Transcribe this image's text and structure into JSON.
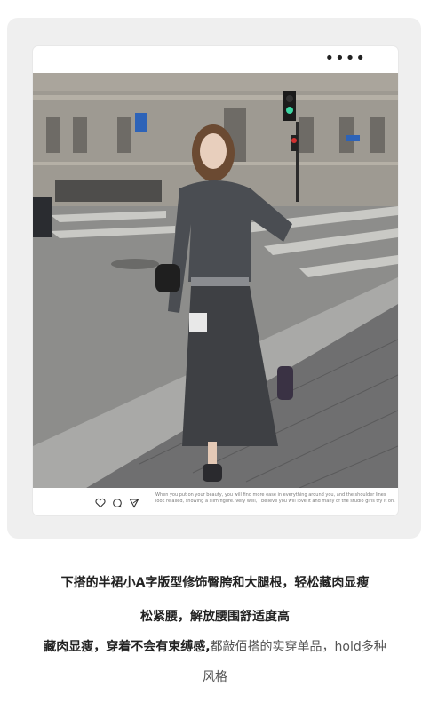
{
  "post": {
    "more_label": "••••",
    "caption": "When you put on your beauty, you will find more ease in everything around you, and the shoulder lines look relaxed, showing a slim figure. Very well, I believe you will love it and many of the studio girls try it on."
  },
  "description": {
    "line1": "下搭的半裙小A字版型修饰臀胯和大腿根，轻松藏肉显瘦",
    "line2": "松紧腰，解放腰围舒适度高",
    "line3_bold": "藏肉显瘦，穿着不会有束缚感,",
    "line3_light": "都敲佰搭的实穿单品，hold多种",
    "line4": "风格"
  },
  "icons": [
    "heart-icon",
    "comment-icon",
    "share-icon"
  ],
  "colors": {
    "outer": "#efefef",
    "text": "#222222"
  }
}
